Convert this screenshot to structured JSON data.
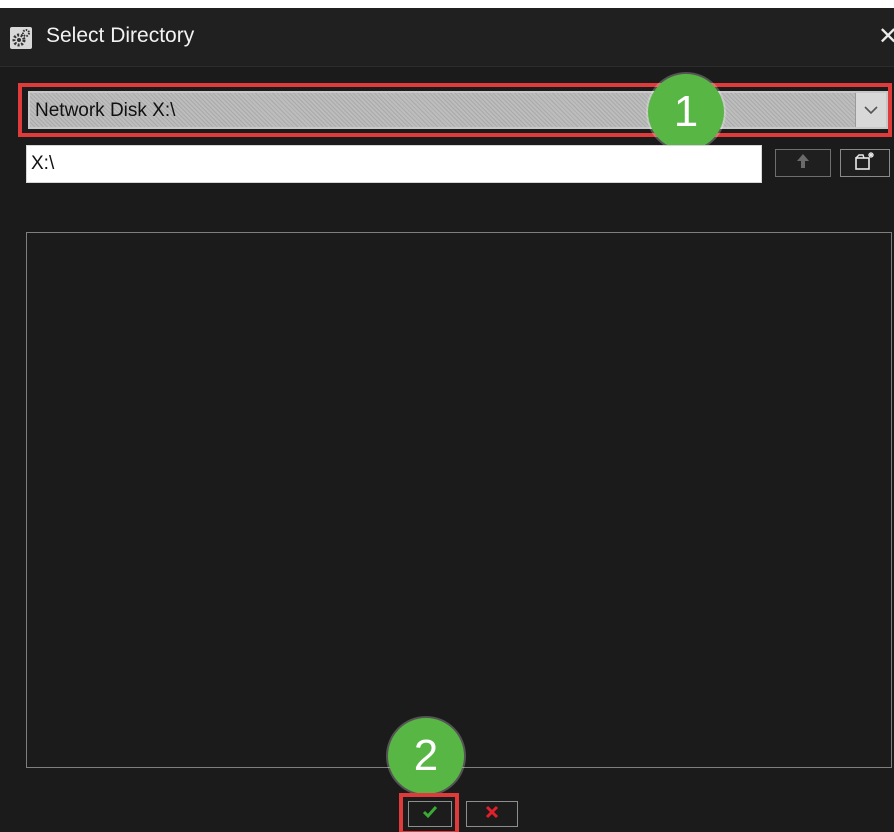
{
  "window": {
    "title": "Select Directory",
    "title_icon": "gear-icon",
    "close_glyph": "✕"
  },
  "drive_select": {
    "selected": "Network Disk X:\\",
    "arrow_icon": "chevron-down-icon"
  },
  "path_field": {
    "value": "X:\\"
  },
  "toolbar": {
    "up_icon": "up-arrow-icon",
    "new_folder_icon": "new-folder-icon"
  },
  "directory_list": {
    "items": []
  },
  "footer": {
    "ok_icon": "checkmark-icon",
    "cancel_icon": "cross-icon"
  },
  "annotations": {
    "step_1": "1",
    "step_2": "2"
  },
  "colors": {
    "highlight": "#e03b3b",
    "badge": "#58b744",
    "confirm": "#3aaa35",
    "cancel": "#e0202a",
    "dialog_bg": "#1b1b1b"
  }
}
